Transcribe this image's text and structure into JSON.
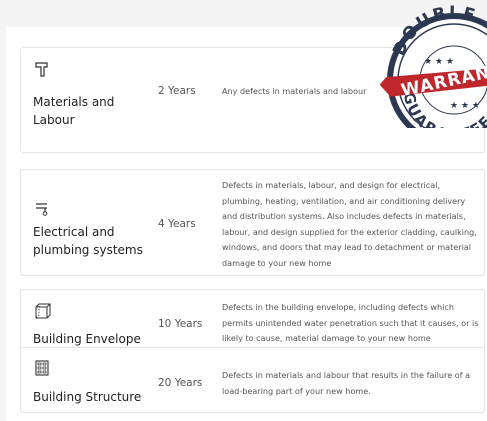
{
  "warranty_rows": [
    {
      "icon": "hammer-icon",
      "title": "Materials and Labour",
      "term": "2 Years",
      "description": "Any defects in materials and labour"
    },
    {
      "icon": "faucet-icon",
      "title": "Electrical and plumbing systems",
      "term": "4 Years",
      "description": "Defects in materials, labour, and design for electrical, plumbing, heating, ventilation, and air conditioning delivery and distribution systems. Also includes defects in materials, labour, and design supplied for the exterior cladding, caulking, windows, and doors that may lead to detachment or material damage to your new home"
    },
    {
      "icon": "cube-icon",
      "title": "Building Envelope",
      "term": "10 Years",
      "description": "Defects in the building envelope, including defects which permits unintended water penetration such that it causes, or is likely to cause, material damage to your new home"
    },
    {
      "icon": "building-icon",
      "title": "Building Structure",
      "term": "20 Years",
      "description": "Defects in materials and labour that results in the failure of a load-bearing part of your new home."
    }
  ],
  "badge": {
    "top_text": "DOUBLE",
    "ribbon_text": "WARRANTY",
    "bottom_text": "GUARANTEE",
    "colors": {
      "navy": "#2c3752",
      "red": "#c0272d"
    }
  }
}
